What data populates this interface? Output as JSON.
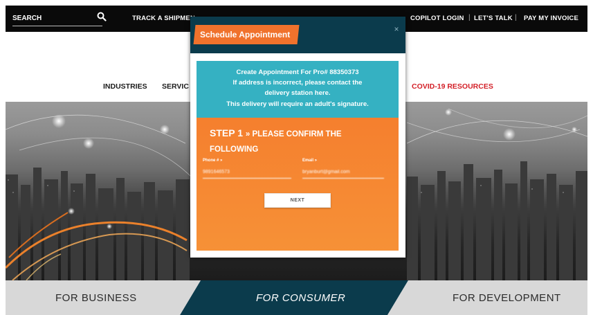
{
  "topbar": {
    "search_placeholder": "SEARCH",
    "links": [
      "TRACK A SHIPMEN",
      "COPILOT LOGIN",
      "LET'S TALK",
      "PAY MY INVOICE"
    ],
    "separators": [
      "|",
      "|"
    ]
  },
  "nav": {
    "items": [
      "INDUSTRIES",
      "SERVIC",
      "COVID-19 RESOURCES"
    ]
  },
  "tabs": {
    "business": "FOR BUSINESS",
    "consumer": "FOR CONSUMER",
    "development": "FOR DEVELOPMENT"
  },
  "modal": {
    "title": "Schedule Appointment",
    "close": "×",
    "info": [
      "Create Appointment For Pro# 88350373",
      "If address is incorrect, please contact the",
      "delivery station here.",
      "This delivery will require an adult's signature."
    ],
    "step_title_big": "STEP 1",
    "step_title_rest": "» PLEASE CONFIRM THE",
    "step_title_line2": "FOLLOWING",
    "phone_label": "Phone # »",
    "phone_value": "9891646573",
    "email_label": "Email »",
    "email_value": "bryanburt@gmail.com",
    "next_label": "NEXT"
  },
  "colors": {
    "accent_orange": "#f0722c",
    "modal_header": "#0b3b4c",
    "info_teal": "#35b1c2",
    "covid_red": "#d31f27",
    "consumer_tab": "#0b3b4c"
  }
}
